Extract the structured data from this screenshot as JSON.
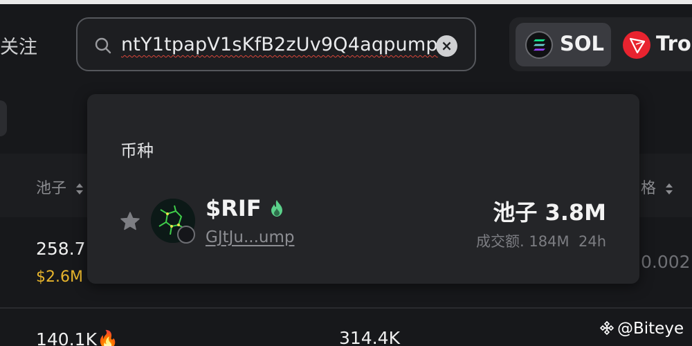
{
  "header": {
    "follow_label": "关注",
    "search": {
      "value": "ntY1tpapV1sKfB2zUv9Q4aqpump",
      "placeholder": ""
    },
    "chains": [
      {
        "name": "SOL",
        "icon": "solana-icon",
        "selected": true
      },
      {
        "name": "Tro",
        "icon": "tron-icon",
        "selected": false
      }
    ]
  },
  "table": {
    "headers": {
      "pool": "池子",
      "price": "格"
    },
    "rows": [
      {
        "pool": "258.7",
        "pool_sub": "$2.6M",
        "price": "0.002"
      },
      {
        "pool": "140.1K",
        "mid": "314.4K"
      }
    ]
  },
  "dropdown": {
    "section_title": "币种",
    "results": [
      {
        "symbol": "$RIF",
        "trending": true,
        "address": "GJtJu...ump",
        "pool_label": "池子 3.8M",
        "volume_label": "成交额. 184M",
        "timeframe": "24h"
      }
    ]
  },
  "watermark": "@Biteye",
  "colors": {
    "background": "#17181b",
    "panel": "#242528",
    "accent_yellow": "#e8b52c",
    "tron_red": "#e8232f",
    "fire_green": "#5bd08a"
  }
}
